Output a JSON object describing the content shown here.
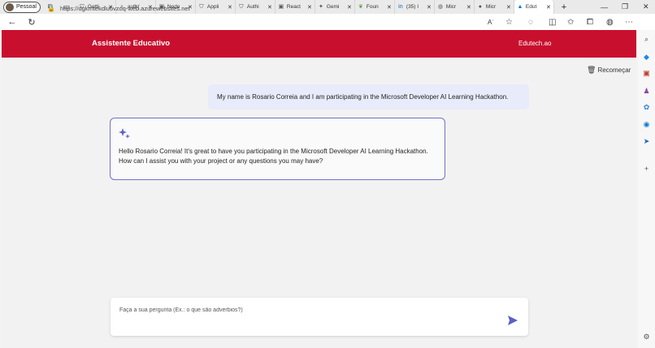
{
  "browser": {
    "profile_label": "Pessoal",
    "tabs": [
      {
        "title": "Getti",
        "icon": "shield"
      },
      {
        "title": "auth(",
        "icon": "search"
      },
      {
        "title": "Node",
        "icon": "page"
      },
      {
        "title": "Appli",
        "icon": "shield"
      },
      {
        "title": "Authi",
        "icon": "shield"
      },
      {
        "title": "React",
        "icon": "page"
      },
      {
        "title": "Gemi",
        "icon": "sparkle"
      },
      {
        "title": "Foun",
        "icon": "leaf"
      },
      {
        "title": "(35) I",
        "icon": "linkedin"
      },
      {
        "title": "Micr",
        "icon": "globe"
      },
      {
        "title": "Micr",
        "icon": "circle"
      },
      {
        "title": "Edut",
        "icon": "azure",
        "active": true
      }
    ],
    "url": "https://dgkmtekdlu6vzoq-web.azurewebsites.net",
    "read_aloud_label": "Aʾ"
  },
  "app": {
    "title": "Assistente Educativo",
    "brand": "Edutech.ao",
    "restart_label": "Recomeçar",
    "accent_color": "#c8102e"
  },
  "chat": {
    "user_message": "My name is Rosario Correia and I am participating in the Microsoft Developer AI Learning Hackathon.",
    "assistant_message": "Hello Rosario Correia! It's great to have you participating in the Microsoft Developer AI Learning Hackathon. How can I assist you with your project or any questions you may have?"
  },
  "composer": {
    "placeholder": "Faça a sua pergunta (Ex.: o que são adverbios?)",
    "value": ""
  }
}
